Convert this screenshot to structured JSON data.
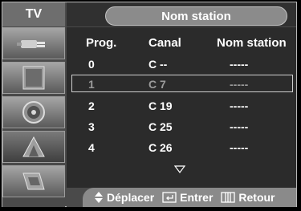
{
  "sidebar": {
    "title": "TV",
    "items": [
      {
        "icon": "plug-icon"
      },
      {
        "icon": "picture-icon"
      },
      {
        "icon": "sound-icon"
      },
      {
        "icon": "channel-icon"
      },
      {
        "icon": "setup-icon"
      }
    ],
    "selected_index": 3
  },
  "header": {
    "title": "Nom station"
  },
  "table": {
    "headers": [
      "Prog.",
      "Canal",
      "Nom station"
    ],
    "rows": [
      {
        "prog": "0",
        "canal": "C --",
        "name": "-----"
      },
      {
        "prog": "1",
        "canal": "C 7",
        "name": "-----"
      },
      {
        "prog": "2",
        "canal": "C 19",
        "name": "-----"
      },
      {
        "prog": "3",
        "canal": "C 25",
        "name": "-----"
      },
      {
        "prog": "4",
        "canal": "C 26",
        "name": "-----"
      }
    ],
    "selected_row": 1
  },
  "footer": {
    "move_label": "Déplacer",
    "enter_label": "Entrer",
    "return_label": "Retour"
  }
}
